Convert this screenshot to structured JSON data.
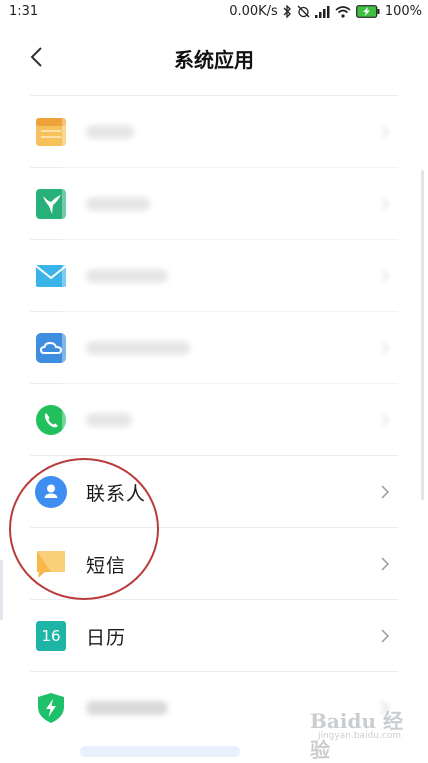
{
  "status_bar": {
    "time": "1:31",
    "speed": "0.00K/s",
    "battery": "100%"
  },
  "header": {
    "title": "系统应用"
  },
  "items": [
    {
      "label": "",
      "icon": "notes-icon",
      "blurred": true
    },
    {
      "label": "",
      "icon": "hummingbird-icon",
      "blurred": true
    },
    {
      "label": "",
      "icon": "mail-icon",
      "blurred": true
    },
    {
      "label": "",
      "icon": "cloud-icon",
      "blurred": true
    },
    {
      "label": "",
      "icon": "phone-icon",
      "blurred": true
    },
    {
      "label": "联系人",
      "icon": "contacts-icon",
      "blurred": false
    },
    {
      "label": "短信",
      "icon": "messages-icon",
      "blurred": false
    },
    {
      "label": "日历",
      "icon": "calendar-icon",
      "blurred": false,
      "icon_text": "16"
    },
    {
      "label": "",
      "icon": "security-shield-icon",
      "blurred": true
    }
  ],
  "watermark": {
    "brand": "Baidu 经验",
    "url": "jingyan.baidu.com"
  },
  "colors": {
    "annotation_circle": "#b83a3a",
    "contacts": "#3d8ef0",
    "messages": "#f7b84a",
    "calendar": "#1fb5a6",
    "phone": "#21c05c",
    "security": "#1fc06a"
  }
}
